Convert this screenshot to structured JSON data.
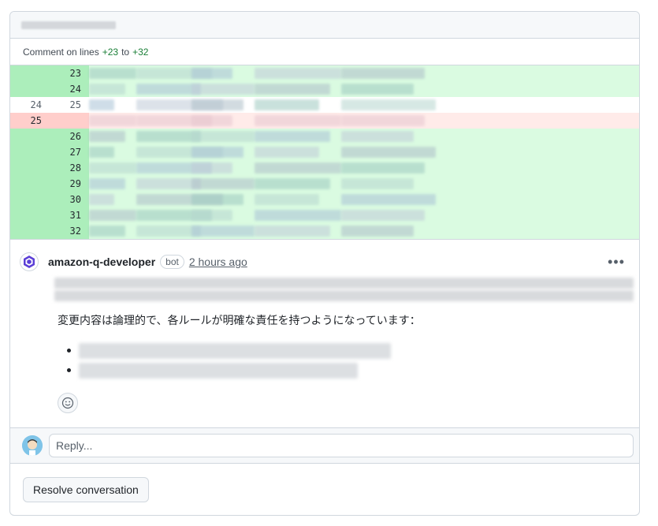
{
  "comment_on": {
    "prefix": "Comment on lines",
    "start": "+23",
    "joiner": "to",
    "end": "+32"
  },
  "diff_lines": [
    {
      "type": "add",
      "old": "",
      "new": "23"
    },
    {
      "type": "add",
      "old": "",
      "new": "24"
    },
    {
      "type": "ctx",
      "old": "24",
      "new": "25"
    },
    {
      "type": "del",
      "old": "25",
      "new": ""
    },
    {
      "type": "add",
      "old": "",
      "new": "26"
    },
    {
      "type": "add",
      "old": "",
      "new": "27"
    },
    {
      "type": "add",
      "old": "",
      "new": "28"
    },
    {
      "type": "add",
      "old": "",
      "new": "29"
    },
    {
      "type": "add",
      "old": "",
      "new": "30"
    },
    {
      "type": "add",
      "old": "",
      "new": "31"
    },
    {
      "type": "add",
      "old": "",
      "new": "32"
    }
  ],
  "comment": {
    "author": "amazon-q-developer",
    "badge": "bot",
    "time": "2 hours ago",
    "text_jp": "変更内容は論理的で、各ルールが明確な責任を持つようになっています："
  },
  "icons": {
    "more": "kebab-horizontal-icon",
    "emoji": "smiley-icon",
    "author_avatar": "amazon-q-logo",
    "user_avatar": "user-avatar-icon"
  },
  "reply": {
    "placeholder": "Reply..."
  },
  "resolve_label": "Resolve conversation",
  "colors": {
    "add_num_bg": "#aceebb",
    "add_code_bg": "#dafbe1",
    "del_num_bg": "#ffcecb",
    "del_code_bg": "#ffebe9",
    "addition_text": "#1a7f37",
    "q_brand": "#5b3fd6"
  }
}
